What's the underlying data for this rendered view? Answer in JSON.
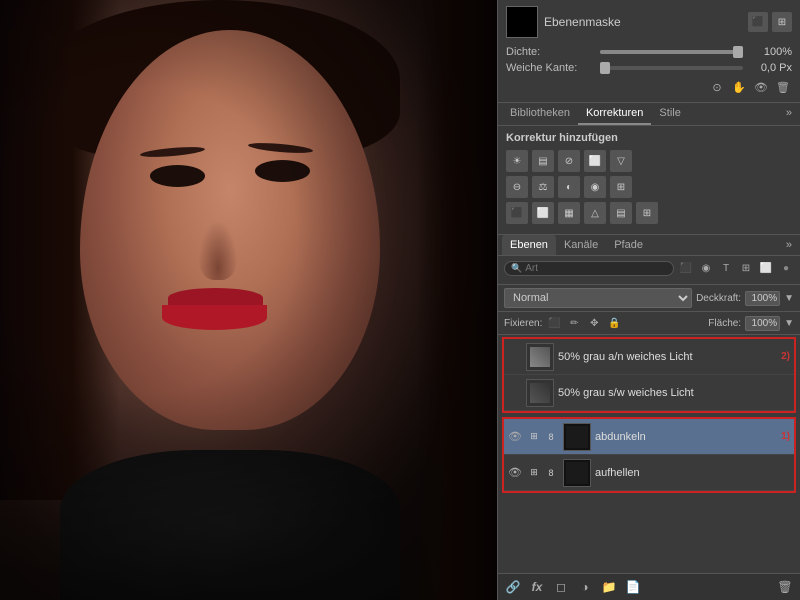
{
  "photo": {
    "alt": "Portrait photo of young woman with dark makeup and red lips"
  },
  "mask_panel": {
    "title": "Ebenenmaske",
    "dichte_label": "Dichte:",
    "dichte_value": "100%",
    "weiche_kante_label": "Weiche Kante:",
    "weiche_kante_value": "0,0 Px"
  },
  "library_tabs": [
    {
      "label": "Bibliotheken",
      "active": false
    },
    {
      "label": "Korrekturen",
      "active": true
    },
    {
      "label": "Stile",
      "active": false
    }
  ],
  "korrekturen": {
    "title": "Korrektur hinzufügen"
  },
  "ebenen_tabs": [
    {
      "label": "Ebenen",
      "active": true
    },
    {
      "label": "Kanäle",
      "active": false
    },
    {
      "label": "Pfade",
      "active": false
    }
  ],
  "layer_controls": {
    "search_placeholder": "Art",
    "blend_mode": "Normal",
    "deckkraft_label": "Deckkraft:",
    "deckkraft_value": "100%",
    "fixieren_label": "Fixieren:",
    "flaeche_label": "Fläche:",
    "flaeche_value": "100%"
  },
  "layers": [
    {
      "id": "layer-50pct-grau-an",
      "label": "50% grau a/n weiches Licht",
      "visible": false,
      "selected": false,
      "group": true,
      "thumb_type": "medium",
      "has_link": false,
      "annotation": "2)"
    },
    {
      "id": "layer-50pct-grau-sw",
      "label": "50% grau s/w weiches Licht",
      "visible": false,
      "selected": false,
      "group": true,
      "thumb_type": "medium",
      "has_link": false,
      "annotation": ""
    },
    {
      "id": "layer-abdunkeln",
      "label": "abdunkeln",
      "visible": true,
      "selected": true,
      "group": false,
      "thumb_type": "dark",
      "has_link": true,
      "annotation": "1)"
    },
    {
      "id": "layer-aufhellen",
      "label": "aufhellen",
      "visible": true,
      "selected": false,
      "group": false,
      "thumb_type": "dark",
      "has_link": true,
      "annotation": ""
    }
  ],
  "bottom_toolbar": {
    "icons": [
      "link",
      "fx",
      "mask",
      "folder-new",
      "layer-new",
      "trash"
    ]
  }
}
